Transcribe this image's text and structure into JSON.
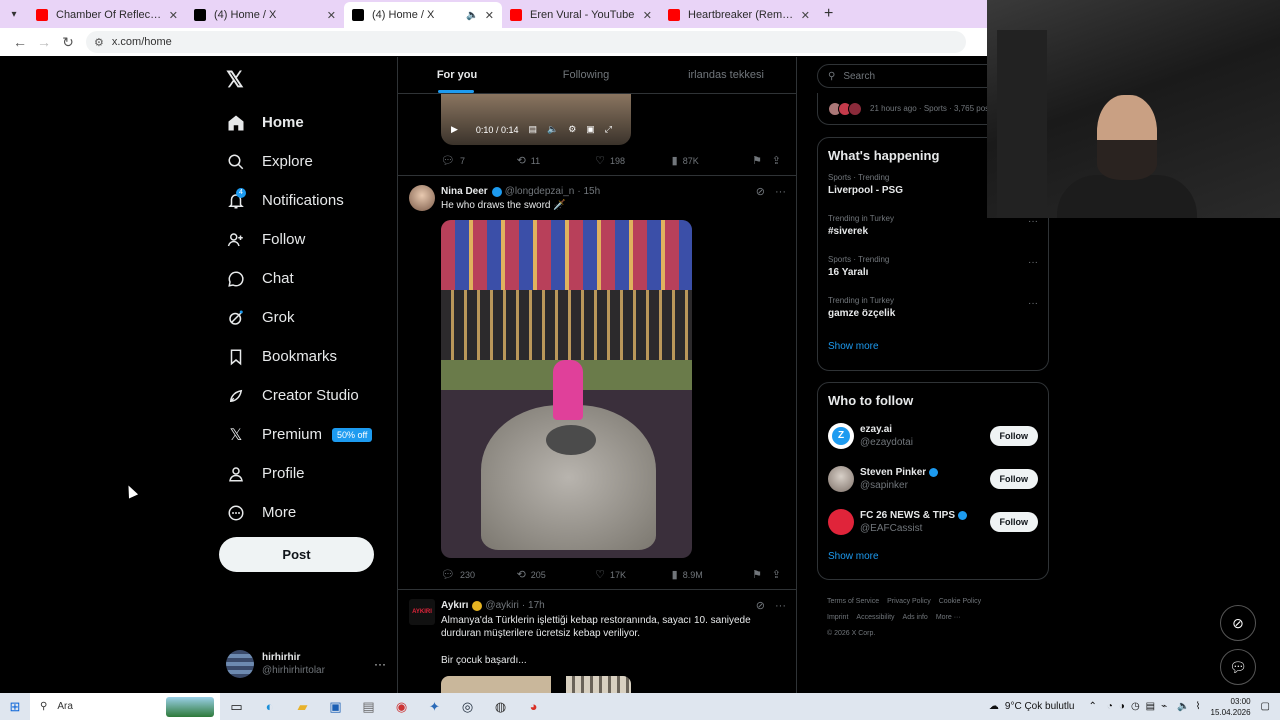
{
  "browser": {
    "tabs": [
      {
        "title": "Chamber Of Reflection - YouTube",
        "color": "#ff0000"
      },
      {
        "title": "(4) Home / X",
        "color": "#000000"
      },
      {
        "title": "(4) Home / X",
        "color": "#000000",
        "active": true
      },
      {
        "title": "Eren Vural - YouTube",
        "color": "#ff0000"
      },
      {
        "title": "Heartbreaker (Remastered) - YouTube",
        "color": "#ff0000"
      }
    ],
    "url": "x.com/home"
  },
  "nav": {
    "items": [
      {
        "label": "Home",
        "icon": "home-icon"
      },
      {
        "label": "Explore",
        "icon": "search-icon"
      },
      {
        "label": "Notifications",
        "icon": "bell-icon",
        "badge": "4"
      },
      {
        "label": "Follow",
        "icon": "follow-icon"
      },
      {
        "label": "Chat",
        "icon": "chat-icon"
      },
      {
        "label": "Grok",
        "icon": "grok-icon"
      },
      {
        "label": "Bookmarks",
        "icon": "bookmark-icon"
      },
      {
        "label": "Creator Studio",
        "icon": "rocket-icon"
      },
      {
        "label": "Premium",
        "icon": "x-icon",
        "pill": "50% off"
      },
      {
        "label": "Profile",
        "icon": "person-icon"
      },
      {
        "label": "More",
        "icon": "more-circle-icon"
      }
    ],
    "post_label": "Post",
    "account": {
      "name": "hirhirhir",
      "handle": "@hirhirhirtolar"
    }
  },
  "feed": {
    "tabs": [
      "For you",
      "Following",
      "irlandas tekkesi"
    ],
    "video_time": "0:10 / 0:14",
    "tweet0_actions": {
      "replies": "7",
      "reposts": "11",
      "likes": "198",
      "views": "87K"
    },
    "tweet1": {
      "name": "Nina Deer",
      "handle": "@longdepzai_n",
      "time": "· 15h",
      "text": "He who draws the sword 🗡️",
      "actions": {
        "replies": "230",
        "reposts": "205",
        "likes": "17K",
        "views": "8.9M"
      }
    },
    "tweet2": {
      "name": "Aykırı",
      "handle": "@aykiri",
      "time": "· 17h",
      "avatar_text": "AYKIRI",
      "text": "Almanya'da Türklerin işlettiği kebap restoranında, sayacı 10. saniyede durduran müşterilere ücretsiz kebap veriliyor.",
      "text2": "Bir çocuk başardı..."
    }
  },
  "sidebar": {
    "search_placeholder": "Search",
    "live_meta": "21 hours ago · Sports · 3,765 posts",
    "happening_title": "What's happening",
    "trends": [
      {
        "meta": "Sports · Trending",
        "title": "Liverpool - PSG"
      },
      {
        "meta": "Trending in Turkey",
        "title": "#siverek"
      },
      {
        "meta": "Sports · Trending",
        "title": "16 Yaralı"
      },
      {
        "meta": "Trending in Turkey",
        "title": "gamze özçelik"
      }
    ],
    "show_more": "Show more",
    "wtf_title": "Who to follow",
    "wtf": [
      {
        "name": "ezay.ai",
        "handle": "@ezaydotai",
        "verified": false,
        "color": "#1d9bf0"
      },
      {
        "name": "Steven Pinker",
        "handle": "@sapinker",
        "verified": true,
        "color": "#8a8a8a"
      },
      {
        "name": "FC 26 NEWS & TIPS",
        "handle": "@EAFCassist",
        "verified": true,
        "color": "#e0243a"
      }
    ],
    "follow_label": "Follow",
    "footer": [
      "Terms of Service",
      "Privacy Policy",
      "Cookie Policy",
      "Imprint",
      "Accessibility",
      "Ads info",
      "More ···",
      "© 2026 X Corp."
    ]
  },
  "taskbar": {
    "search": "Ara",
    "weather": "9°C  Çok bulutlu",
    "time": "03:00",
    "date": "15.04.2026"
  },
  "colors": {
    "accent": "#1d9bf0",
    "background": "#000000"
  }
}
